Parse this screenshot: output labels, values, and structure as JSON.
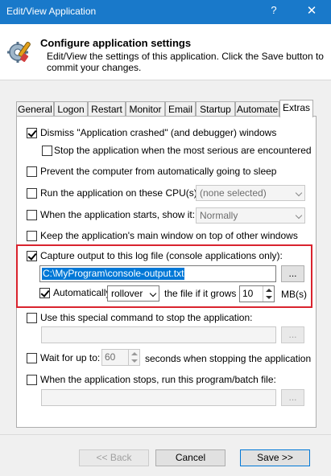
{
  "window": {
    "title": "Edit/View Application",
    "help_label": "?",
    "close_label": "✕"
  },
  "header": {
    "title": "Configure application settings",
    "description": "Edit/View the settings of this application. Click the Save button to commit your changes."
  },
  "tabs": [
    {
      "label": "General"
    },
    {
      "label": "Logon"
    },
    {
      "label": "Restart"
    },
    {
      "label": "Monitor"
    },
    {
      "label": "Email"
    },
    {
      "label": "Startup"
    },
    {
      "label": "Automate"
    },
    {
      "label": "Extras"
    }
  ],
  "active_tab": "Extras",
  "extras": {
    "dismiss_crashed": {
      "label": "Dismiss \"Application crashed\" (and debugger) windows",
      "checked": true
    },
    "stop_serious": {
      "label": "Stop the application when the most serious are encountered",
      "checked": false
    },
    "prevent_sleep": {
      "label": "Prevent the computer from automatically going to sleep",
      "checked": false
    },
    "run_on_cpus": {
      "label": "Run the application on these CPU(s):",
      "checked": false,
      "combo_value": "(none selected)"
    },
    "show_on_start": {
      "label": "When the application starts, show it:",
      "checked": false,
      "combo_value": "Normally"
    },
    "keep_on_top": {
      "label": "Keep the application's main window on top of other windows",
      "checked": false
    },
    "capture_output": {
      "label": "Capture output to this log file (console applications only):",
      "checked": true,
      "path_value": "C:\\MyProgram\\console-output.txt",
      "browse_label": "...",
      "auto_label": "Automatically",
      "auto_checked": true,
      "mode_value": "rollover",
      "grows_label": "the file if it grows to",
      "size_value": "10",
      "unit_label": "MB(s)"
    },
    "stop_command": {
      "label": "Use this special command to stop the application:",
      "checked": false,
      "value": "",
      "browse_label": "..."
    },
    "wait_for": {
      "label": "Wait for up to:",
      "checked": false,
      "value": "60",
      "suffix_label": "seconds when stopping the application"
    },
    "run_on_stop": {
      "label": "When the application stops, run this program/batch file:",
      "checked": false,
      "value": "",
      "browse_label": "..."
    }
  },
  "footer": {
    "back_label": "<< Back",
    "cancel_label": "Cancel",
    "save_label": "Save >>"
  },
  "colors": {
    "titlebar": "#1979ca",
    "highlight_box": "#d9232e",
    "selection": "#0078d7"
  }
}
